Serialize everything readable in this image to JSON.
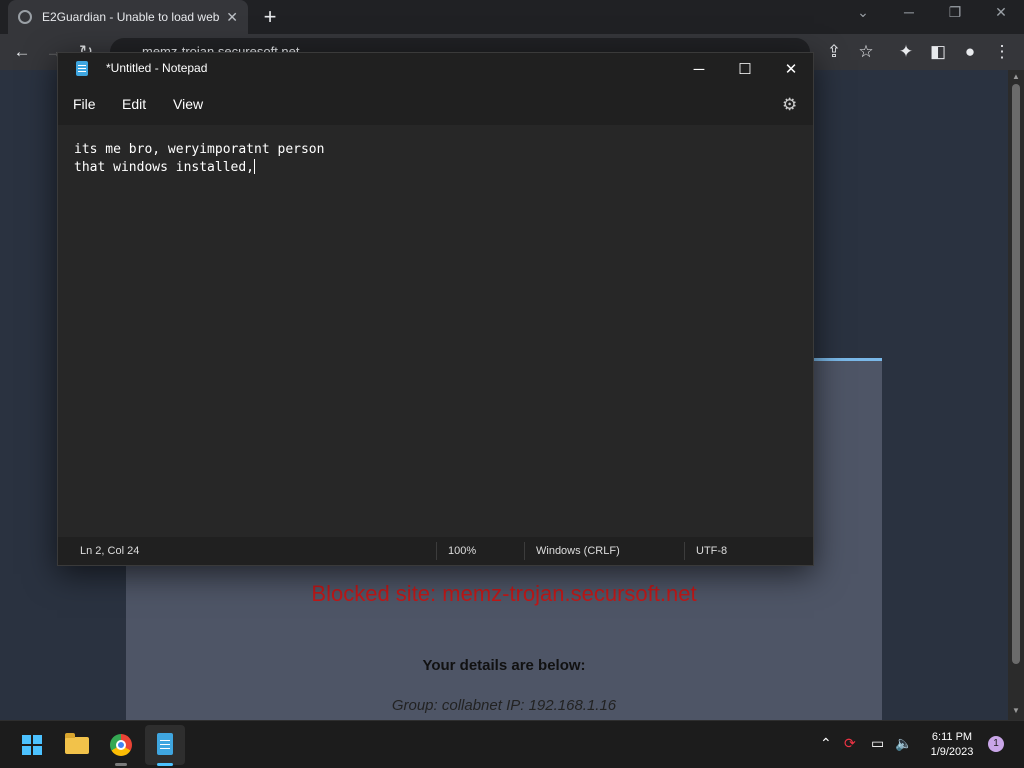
{
  "browser": {
    "tab_title": "E2Guardian - Unable to load web",
    "new_tab": "+",
    "tab_close": "✕",
    "url": "memz-trojan.securesoft.net"
  },
  "blocked_page": {
    "blocked_text": "Blocked site: memz-trojan.secursoft.net",
    "details_heading": "Your details are below:",
    "group_line": "Group: collabnet   IP: 192.168.1.16"
  },
  "notepad": {
    "title": "*Untitled - Notepad",
    "menu": {
      "file": "File",
      "edit": "Edit",
      "view": "View"
    },
    "content_line1": "its me bro, weryimporatnt person",
    "content_line2": "that windows installed,",
    "status": {
      "position": "Ln 2, Col 24",
      "zoom": "100%",
      "line_ending": "Windows (CRLF)",
      "encoding": "UTF-8"
    }
  },
  "taskbar": {
    "time": "6:11 PM",
    "date": "1/9/2023",
    "notification_count": "1"
  },
  "colors": {
    "accent": "#4cc2ff",
    "blocked_red": "#c01818",
    "notepad_bg": "#272727"
  }
}
